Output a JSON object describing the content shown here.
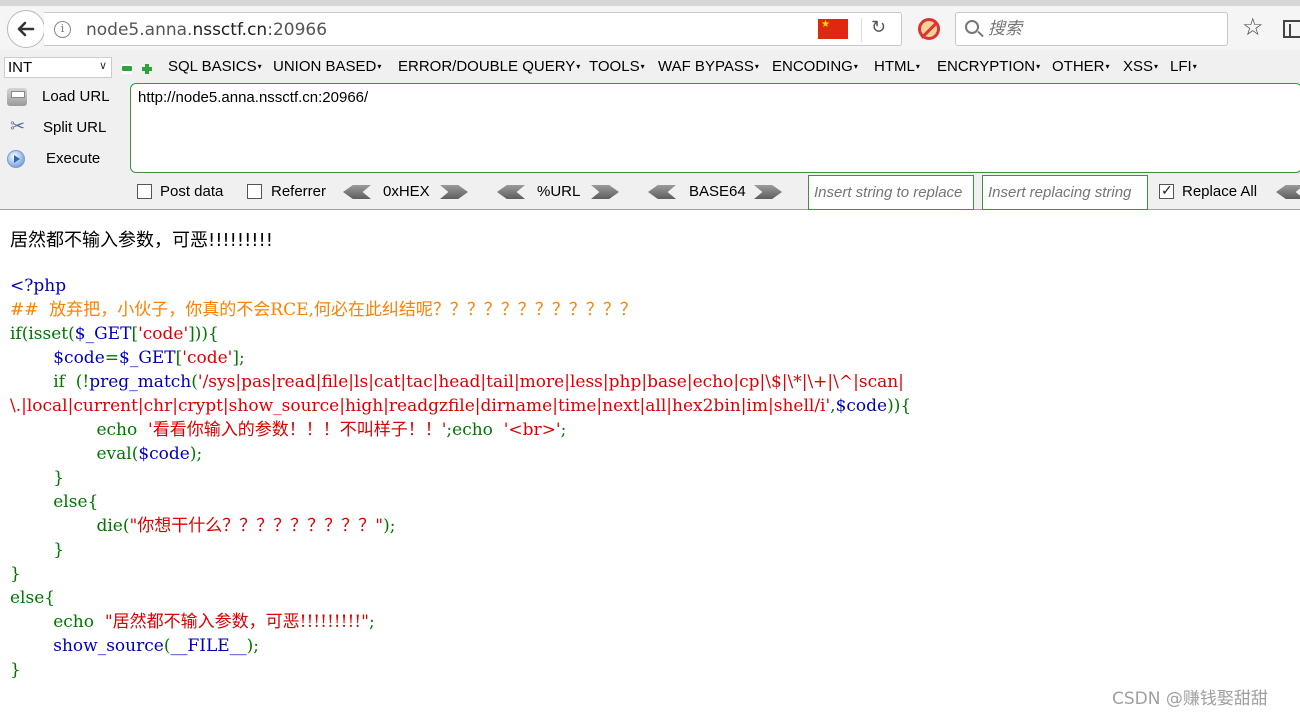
{
  "browser": {
    "url_host": "node5.anna.",
    "url_domain": "nssctf.cn",
    "url_port": ":20966",
    "search_placeholder": "搜索"
  },
  "hackbar": {
    "int_label": "INT",
    "menus": [
      "SQL BASICS",
      "UNION BASED",
      "ERROR/DOUBLE QUERY",
      "TOOLS",
      "WAF BYPASS",
      "ENCODING",
      "HTML",
      "ENCRYPTION",
      "OTHER",
      "XSS",
      "LFI"
    ],
    "load_url": "Load URL",
    "split_url": "Split URL",
    "execute": "Execute",
    "url_value": "http://node5.anna.nssctf.cn:20966/",
    "post_data": "Post data",
    "referrer": "Referrer",
    "hex_label": "0xHEX",
    "url_enc_label": "%URL",
    "base64_label": "BASE64",
    "replace_placeholder": "Insert string to replace",
    "replacing_placeholder": "Insert replacing string",
    "replace_all": "Replace All",
    "replace_all_checked": true
  },
  "page": {
    "message": "居然都不输入参数，可恶!!!!!!!!!",
    "code_lines": [
      [
        {
          "t": "<?php",
          "c": "b"
        }
      ],
      [
        {
          "t": "##  放弃把，小伙子，你真的不会RCE,何必在此纠结呢？？？？？？？？？？？？",
          "c": "o"
        }
      ],
      [
        {
          "t": "if(isset(",
          "c": "g"
        },
        {
          "t": "$_GET",
          "c": "b"
        },
        {
          "t": "[",
          "c": "g"
        },
        {
          "t": "'code'",
          "c": "r"
        },
        {
          "t": "])){",
          "c": "g"
        }
      ],
      [
        {
          "t": "        ",
          "c": "g"
        },
        {
          "t": "$code",
          "c": "b"
        },
        {
          "t": "=",
          "c": "g"
        },
        {
          "t": "$_GET",
          "c": "b"
        },
        {
          "t": "[",
          "c": "g"
        },
        {
          "t": "'code'",
          "c": "r"
        },
        {
          "t": "];",
          "c": "g"
        }
      ],
      [
        {
          "t": "        if  (!",
          "c": "g"
        },
        {
          "t": "preg_match",
          "c": "b"
        },
        {
          "t": "(",
          "c": "g"
        },
        {
          "t": "'/sys|pas|read|file|ls|cat|tac|head|tail|more|less|php|base|echo|cp|\\$|\\*|\\+|\\^|scan|",
          "c": "r"
        }
      ],
      [
        {
          "t": "\\.|local|current|chr|crypt|show_source|high|readgzfile|dirname|time|next|all|hex2bin|im|shell/i'",
          "c": "r"
        },
        {
          "t": ",",
          "c": "g"
        },
        {
          "t": "$code",
          "c": "b"
        },
        {
          "t": ")){",
          "c": "g"
        }
      ],
      [
        {
          "t": "                echo  ",
          "c": "g"
        },
        {
          "t": "'看看你输入的参数！！！不叫样子！！'",
          "c": "r"
        },
        {
          "t": ";echo  ",
          "c": "g"
        },
        {
          "t": "'<br>'",
          "c": "r"
        },
        {
          "t": ";",
          "c": "g"
        }
      ],
      [
        {
          "t": "                eval(",
          "c": "g"
        },
        {
          "t": "$code",
          "c": "b"
        },
        {
          "t": ");",
          "c": "g"
        }
      ],
      [
        {
          "t": "        }",
          "c": "g"
        }
      ],
      [
        {
          "t": "        else{",
          "c": "g"
        }
      ],
      [
        {
          "t": "                die(",
          "c": "g"
        },
        {
          "t": "\"你想干什么？？？？？？？？？\"",
          "c": "r"
        },
        {
          "t": ");",
          "c": "g"
        }
      ],
      [
        {
          "t": "        }",
          "c": "g"
        }
      ],
      [
        {
          "t": "}",
          "c": "g"
        }
      ],
      [
        {
          "t": "else{",
          "c": "g"
        }
      ],
      [
        {
          "t": "        echo  ",
          "c": "g"
        },
        {
          "t": "\"居然都不输入参数，可恶!!!!!!!!!\"",
          "c": "r"
        },
        {
          "t": ";",
          "c": "g"
        }
      ],
      [
        {
          "t": "        ",
          "c": "g"
        },
        {
          "t": "show_source",
          "c": "b"
        },
        {
          "t": "(",
          "c": "g"
        },
        {
          "t": "__FILE__",
          "c": "b"
        },
        {
          "t": ");",
          "c": "g"
        }
      ],
      [
        {
          "t": "}",
          "c": "g"
        }
      ]
    ],
    "watermark": "CSDN @赚钱娶甜甜"
  }
}
